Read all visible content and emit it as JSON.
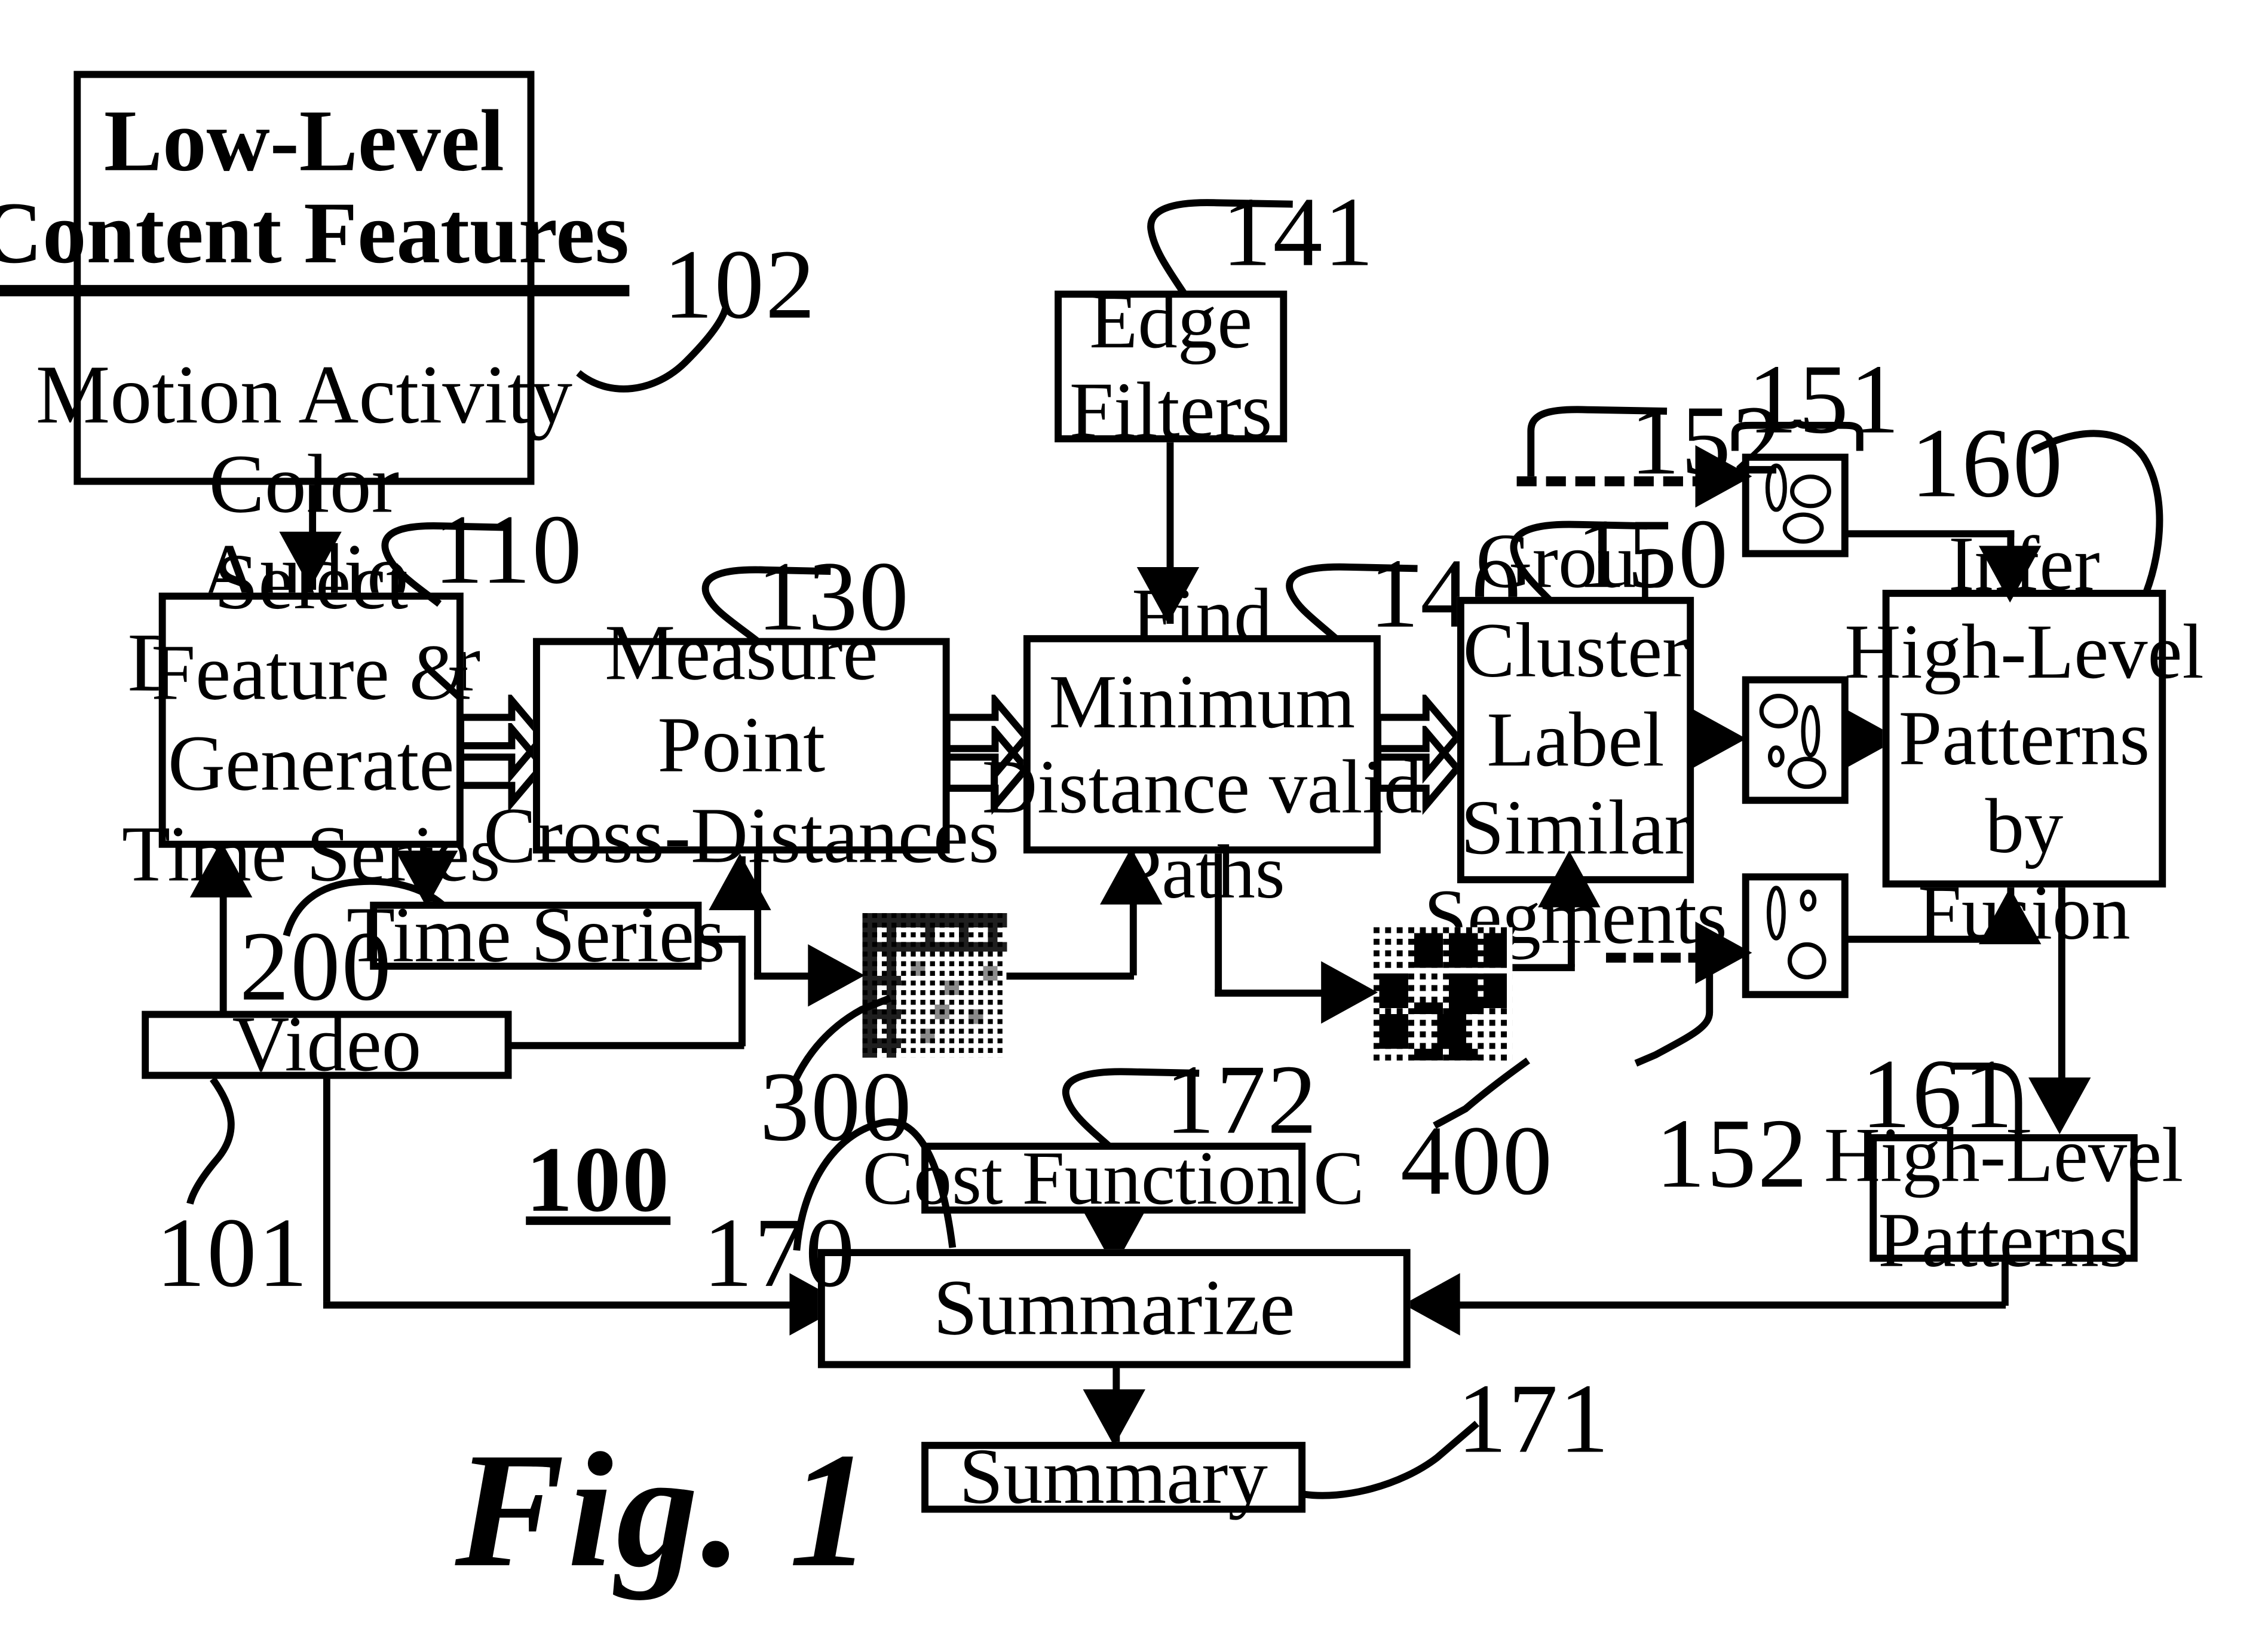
{
  "figure": {
    "caption": "Fig. 1",
    "system_ref": "100"
  },
  "boxes": {
    "low_level_features": {
      "title_line1": "Low-Level",
      "title_line2": "Content Features",
      "items": [
        "Motion Activity",
        "Color",
        "Audio",
        "Descriptor"
      ],
      "ref": "102"
    },
    "select_feature": {
      "lines": [
        "Select",
        "Feature &",
        "Generate",
        "Time Series"
      ],
      "ref": "110"
    },
    "measure_point": {
      "lines": [
        "Measure",
        "Point",
        "Cross-Distances"
      ],
      "ref": "130"
    },
    "find_minimum": {
      "lines": [
        "Find",
        "Minimum",
        "Distance valid",
        "Paths"
      ],
      "ref": "140"
    },
    "edge_filters": {
      "lines": [
        "Edge",
        "Filters"
      ],
      "ref": "141"
    },
    "group_cluster": {
      "lines": [
        "Group",
        "Cluster",
        "Label",
        "Similar",
        "Segments"
      ],
      "ref": "150"
    },
    "infer_high_level": {
      "lines": [
        "Infer",
        "High-Level",
        "Patterns",
        "by",
        "Fusion"
      ],
      "ref": "160"
    },
    "high_level_patterns": {
      "lines": [
        "High-Level",
        "Patterns"
      ],
      "ref": "161"
    },
    "time_series": {
      "label": "Time Series",
      "ref": "200"
    },
    "video": {
      "label": "Video",
      "ref": "101"
    },
    "cost_function": {
      "label": "Cost Function C",
      "ref": "172"
    },
    "summarize": {
      "label": "Summarize",
      "ref": "170"
    },
    "summary": {
      "label": "Summary",
      "ref": "171"
    }
  },
  "artifacts": {
    "distance_matrix": {
      "ref": "300",
      "name": "cross-distance-matrix-image"
    },
    "cluster_matrix": {
      "ref": "400",
      "name": "segment-cluster-matrix-image"
    },
    "key_frames_ref": "151",
    "dashed_input_ref": "152"
  },
  "refnums": {
    "n100": "100",
    "n101": "101",
    "n102": "102",
    "n110": "110",
    "n130": "130",
    "n140": "140",
    "n141": "141",
    "n150": "150",
    "n151": "151",
    "n152_top": "152",
    "n152_bottom": "152",
    "n160": "160",
    "n161": "161",
    "n170": "170",
    "n171": "171",
    "n172": "172",
    "n200": "200",
    "n300": "300",
    "n400": "400"
  },
  "colors": {
    "ink": "#000000",
    "paper": "#ffffff"
  }
}
